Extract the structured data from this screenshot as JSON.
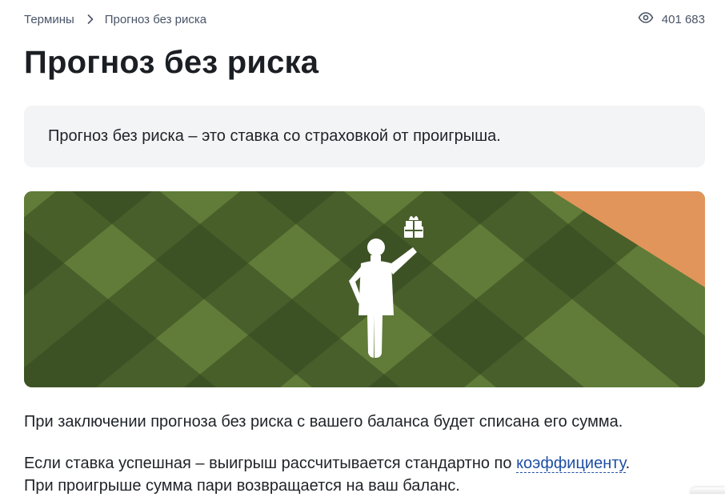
{
  "breadcrumbs": {
    "parent_label": "Термины",
    "current_label": "Прогноз без риска"
  },
  "views": {
    "count": "401 683",
    "icon": "eye-icon"
  },
  "title": "Прогноз без риска",
  "definition": "Прогноз без риска – это ставка со страховкой от проигрыша.",
  "banner": {
    "colors": {
      "dark": "#35471f",
      "mid": "#485f2c",
      "light": "#63803a",
      "accent": "#e2955a",
      "figure": "#ffffff"
    }
  },
  "body": {
    "paragraph1": "При заключении прогноза без риска с вашего баланса будет списана его сумма.",
    "paragraph2_before": "Если ставка успешная – выигрыш рассчитывается стандартно по ",
    "paragraph2_link": "коэффициенту",
    "paragraph2_after": ".",
    "paragraph3": "При проигрыше сумма пари возвращается на ваш баланс."
  }
}
